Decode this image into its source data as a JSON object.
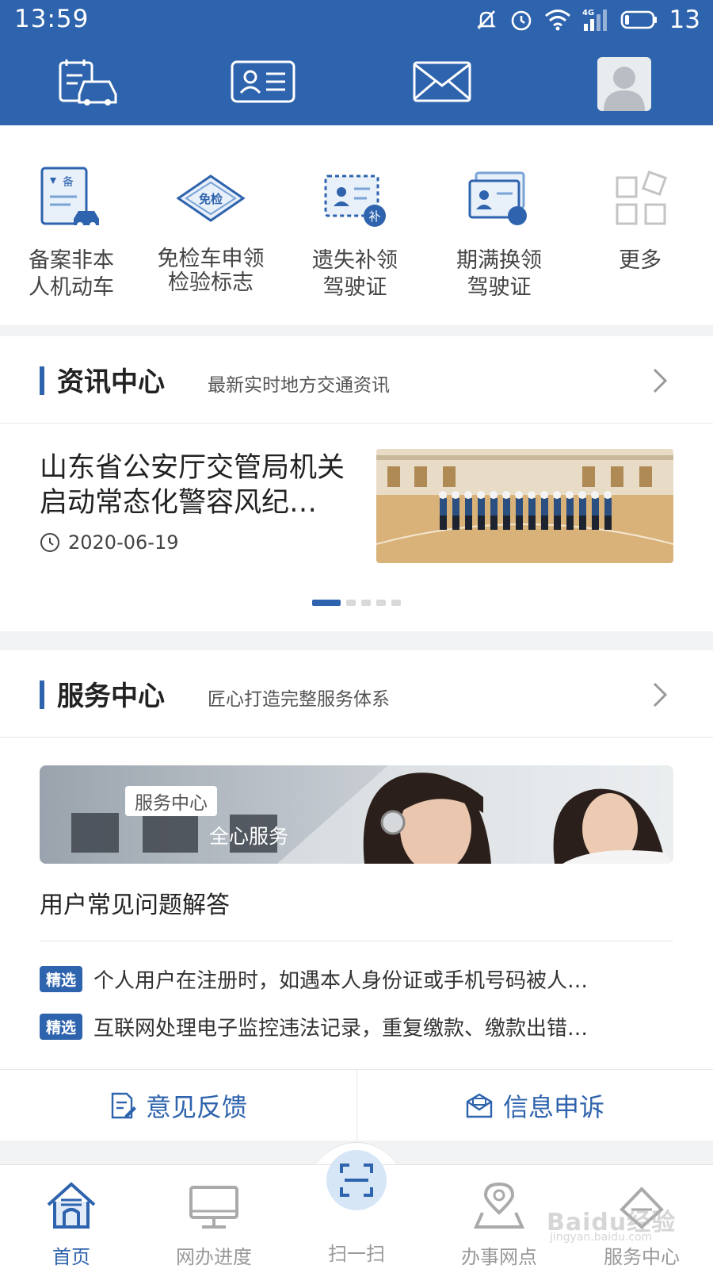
{
  "status": {
    "time": "13:59",
    "battery": "13",
    "network": "4G"
  },
  "topbar": {
    "icons": [
      "vehicle-schedule-icon",
      "id-card-icon",
      "mail-icon",
      "avatar"
    ]
  },
  "quick_services": [
    {
      "label_line1": "备案非本",
      "label_line2": "人机动车",
      "icon": "vehicle-record-icon",
      "badge": "备"
    },
    {
      "label_line1": "免检车申领",
      "label_line2": "检验标志",
      "icon": "inspection-exempt-icon",
      "badge": "免检"
    },
    {
      "label_line1": "遗失补领",
      "label_line2": "驾驶证",
      "icon": "license-reissue-icon",
      "badge": "补"
    },
    {
      "label_line1": "期满换领",
      "label_line2": "驾驶证",
      "icon": "license-renew-icon"
    },
    {
      "label_line1": "更多",
      "label_line2": "",
      "icon": "more-grid-icon"
    }
  ],
  "news": {
    "title": "资讯中心",
    "subtitle": "最新实时地方交通资讯",
    "article": {
      "headline": "山东省公安厅交管局机关启动常态化警容风纪…",
      "date": "2020-06-19"
    },
    "pager": {
      "current": 1,
      "total": 5
    }
  },
  "service": {
    "title": "服务中心",
    "subtitle": "匠心打造完整服务体系",
    "banner_tag": "服务中心",
    "banner_text": "全心服务",
    "faq_title": "用户常见问题解答",
    "faq_tag": "精选",
    "faqs": [
      "个人用户在注册时，如遇本人身份证或手机号码被人…",
      "互联网处理电子监控违法记录，重复缴款、缴款出错…"
    ],
    "actions": [
      {
        "label": "意见反馈",
        "icon": "feedback-icon"
      },
      {
        "label": "信息申诉",
        "icon": "appeal-icon"
      }
    ]
  },
  "bottom_nav": [
    {
      "label": "首页",
      "icon": "home-icon",
      "active": true
    },
    {
      "label": "网办进度",
      "icon": "monitor-icon",
      "active": false
    },
    {
      "label": "扫一扫",
      "icon": "scan-icon",
      "active": false
    },
    {
      "label": "办事网点",
      "icon": "location-icon",
      "active": false
    },
    {
      "label": "服务中心",
      "icon": "service-icon",
      "active": false
    }
  ],
  "watermark": {
    "text": "Baidu经验",
    "sub": "jingyan.baidu.com"
  },
  "colors": {
    "brand": "#2e63ad",
    "background": "#f2f3f5",
    "tag": "#2e63ad"
  }
}
